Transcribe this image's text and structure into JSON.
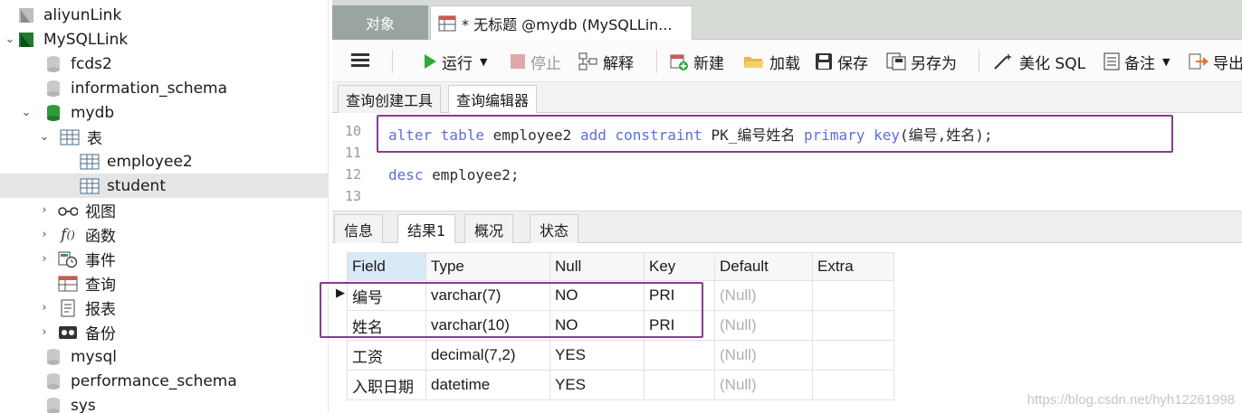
{
  "sidebar": {
    "items": [
      {
        "label": "aliyunLink"
      },
      {
        "label": "MySQLLink"
      },
      {
        "label": "fcds2"
      },
      {
        "label": "information_schema"
      },
      {
        "label": "mydb"
      },
      {
        "label": "表"
      },
      {
        "label": "employee2"
      },
      {
        "label": "student"
      },
      {
        "label": "视图"
      },
      {
        "label": "函数"
      },
      {
        "label": "事件"
      },
      {
        "label": "查询"
      },
      {
        "label": "报表"
      },
      {
        "label": "备份"
      },
      {
        "label": "mysql"
      },
      {
        "label": "performance_schema"
      },
      {
        "label": "sys"
      }
    ]
  },
  "tabs": {
    "objects": "对象",
    "query": "* 无标题 @mydb (MySQLLin..."
  },
  "toolbar": {
    "run": "运行",
    "stop": "停止",
    "explain": "解释",
    "new": "新建",
    "load": "加载",
    "save": "保存",
    "save_as": "另存为",
    "beautify": "美化 SQL",
    "note": "备注",
    "export": "导出"
  },
  "subtabs": [
    "查询创建工具",
    "查询编辑器"
  ],
  "editor": {
    "line_numbers": [
      "10",
      "11",
      "12",
      "13"
    ],
    "line10": {
      "kw1": "alter table",
      "id1": "employee2",
      "kw2": "add constraint",
      "id2": "PK_编号姓名",
      "kw3": "primary key",
      "rest": "(编号,姓名);"
    },
    "line12": {
      "kw": "desc",
      "rest": "employee2;"
    }
  },
  "result_tabs": [
    "信息",
    "结果1",
    "概况",
    "状态"
  ],
  "grid": {
    "columns": [
      "Field",
      "Type",
      "Null",
      "Key",
      "Default",
      "Extra"
    ],
    "rows": [
      [
        "编号",
        "varchar(7)",
        "NO",
        "PRI",
        "(Null)",
        ""
      ],
      [
        "姓名",
        "varchar(10)",
        "NO",
        "PRI",
        "(Null)",
        ""
      ],
      [
        "工资",
        "decimal(7,2)",
        "YES",
        "",
        "(Null)",
        ""
      ],
      [
        "入职日期",
        "datetime",
        "YES",
        "",
        "(Null)",
        ""
      ]
    ]
  },
  "watermark": "https://blog.csdn.net/hyh12261998"
}
